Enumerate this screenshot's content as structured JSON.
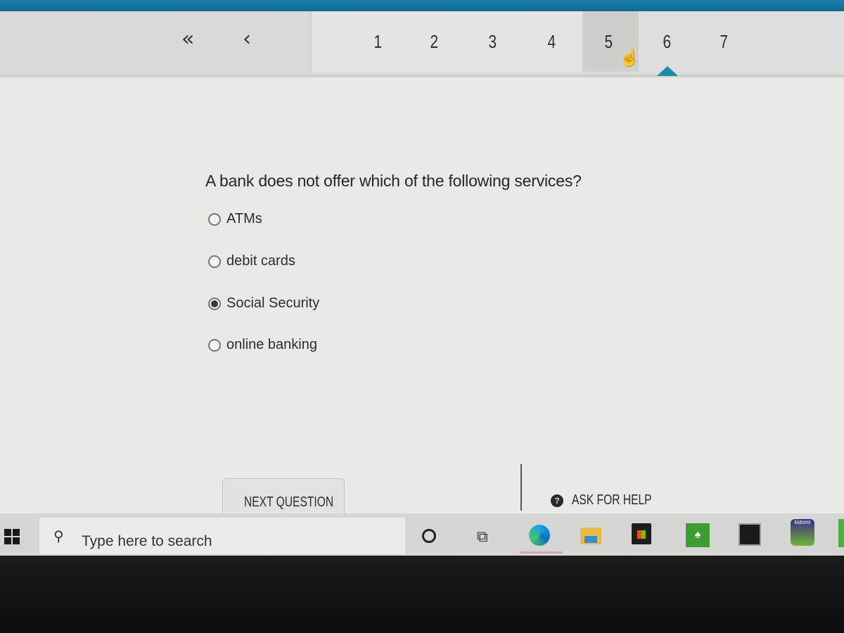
{
  "nav": {
    "first_label": "«",
    "prev_label": "‹",
    "pages": [
      "1",
      "2",
      "3",
      "4",
      "5",
      "6",
      "7"
    ],
    "current_page": "5",
    "marked_page": "6",
    "accent_color": "#1b8aa4"
  },
  "question": {
    "text": "A bank does not offer which of the following services?",
    "options": [
      {
        "label": "ATMs",
        "selected": false
      },
      {
        "label": "debit cards",
        "selected": false
      },
      {
        "label": "Social Security",
        "selected": true
      },
      {
        "label": "online banking",
        "selected": false
      }
    ]
  },
  "footer": {
    "next_label": "NEXT QUESTION",
    "help_label": "ASK FOR HELP",
    "help_icon": "?"
  },
  "taskbar": {
    "search_placeholder": "Type here to search",
    "search_icon": "⚲",
    "taskview_icon": "⧉",
    "solitaire_icon": "♠",
    "kidomi_label": "kidomi"
  },
  "icons": [
    "windows-start-icon",
    "search-icon",
    "cortana-icon",
    "task-view-icon",
    "edge-icon",
    "file-explorer-icon",
    "store-icon",
    "solitaire-icon",
    "laptop-app-icon",
    "kidomi-icon"
  ]
}
